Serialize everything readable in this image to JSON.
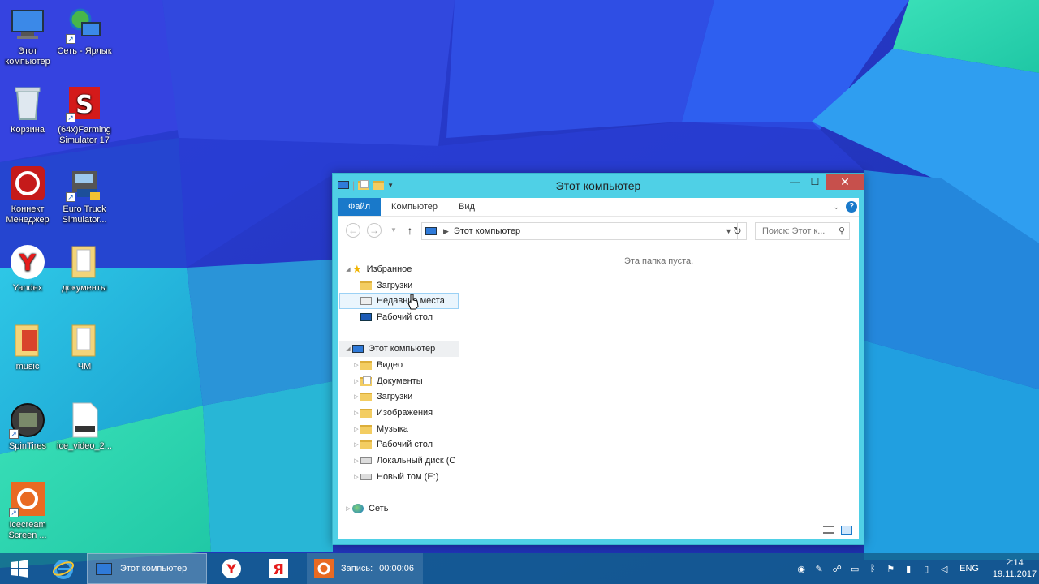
{
  "desktop": {
    "icons": [
      {
        "label": "Этот компьютер"
      },
      {
        "label": "Сеть - Ярлык"
      },
      {
        "label": "Корзина"
      },
      {
        "label": "(64x)Farming Simulator 17"
      },
      {
        "label": "Коннект Менеджер"
      },
      {
        "label": "Euro Truck Simulator..."
      },
      {
        "label": "Yandex"
      },
      {
        "label": "документы"
      },
      {
        "label": "music"
      },
      {
        "label": "ЧМ"
      },
      {
        "label": "SpinTires"
      },
      {
        "label": "ice_video_2..."
      },
      {
        "label": "Icecream Screen ..."
      }
    ]
  },
  "window": {
    "title": "Этот компьютер",
    "close_glyph": "✕",
    "max_glyph": "☐",
    "min_glyph": "—",
    "ribbon": {
      "tabs": [
        "Файл",
        "Компьютер",
        "Вид"
      ]
    },
    "address": {
      "path": "Этот компьютер",
      "search_placeholder": "Поиск: Этот к..."
    },
    "empty_message": "Эта папка пуста.",
    "tree": {
      "favorites": "Избранное",
      "fav_items": [
        "Загрузки",
        "Недавние места",
        "Рабочий стол"
      ],
      "this_pc": "Этот компьютер",
      "pc_items": [
        "Видео",
        "Документы",
        "Загрузки",
        "Изображения",
        "Музыка",
        "Рабочий стол",
        "Локальный диск (C",
        "Новый том (E:)"
      ],
      "network": "Сеть"
    }
  },
  "taskbar": {
    "explorer_label": "Этот компьютер",
    "recording_label": "Запись:",
    "recording_time": "00:00:06",
    "language": "ENG",
    "time": "2:14",
    "date": "19.11.2017"
  },
  "colors": {
    "accent": "#1979ca",
    "window_frame": "#4fd0e6",
    "close_button": "#c7504c",
    "taskbar": "#12608c"
  }
}
